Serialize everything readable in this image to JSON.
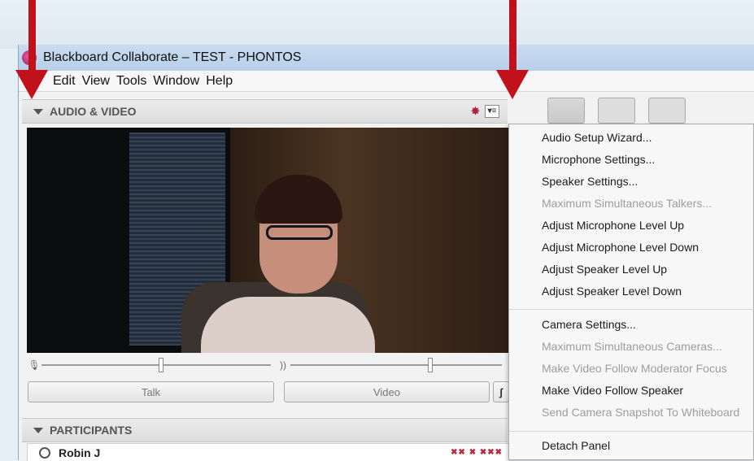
{
  "window": {
    "title": "Blackboard Collaborate – TEST - PHONTOS"
  },
  "menubar": {
    "items": [
      "Edit",
      "View",
      "Tools",
      "Window",
      "Help"
    ]
  },
  "av_panel": {
    "title": "AUDIO & VIDEO",
    "talk_label": "Talk",
    "video_label": "Video",
    "extra_label": "ʃ"
  },
  "participants_panel": {
    "title": "PARTICIPANTS",
    "rows": [
      {
        "name": "Robin J"
      }
    ]
  },
  "dropdown": {
    "items": [
      {
        "label": "Audio Setup Wizard...",
        "enabled": true
      },
      {
        "label": "Microphone Settings...",
        "enabled": true
      },
      {
        "label": "Speaker Settings...",
        "enabled": true
      },
      {
        "label": "Maximum Simultaneous Talkers...",
        "enabled": false
      },
      {
        "label": "Adjust Microphone Level Up",
        "enabled": true
      },
      {
        "label": "Adjust Microphone Level Down",
        "enabled": true
      },
      {
        "label": "Adjust Speaker Level Up",
        "enabled": true
      },
      {
        "label": "Adjust Speaker Level Down",
        "enabled": true
      },
      {
        "label": "Camera Settings...",
        "enabled": true
      },
      {
        "label": "Maximum Simultaneous Cameras...",
        "enabled": false
      },
      {
        "label": "Make Video Follow Moderator Focus",
        "enabled": false
      },
      {
        "label": "Make Video Follow Speaker",
        "enabled": true
      },
      {
        "label": "Send Camera Snapshot To Whiteboard",
        "enabled": false
      },
      {
        "label": "Detach Panel",
        "enabled": true
      }
    ]
  },
  "levels": {
    "microphone": 0.52,
    "speaker": 0.66
  },
  "colors": {
    "annotation_arrow": "#c1121b",
    "disabled_text": "#9d9d9d"
  }
}
